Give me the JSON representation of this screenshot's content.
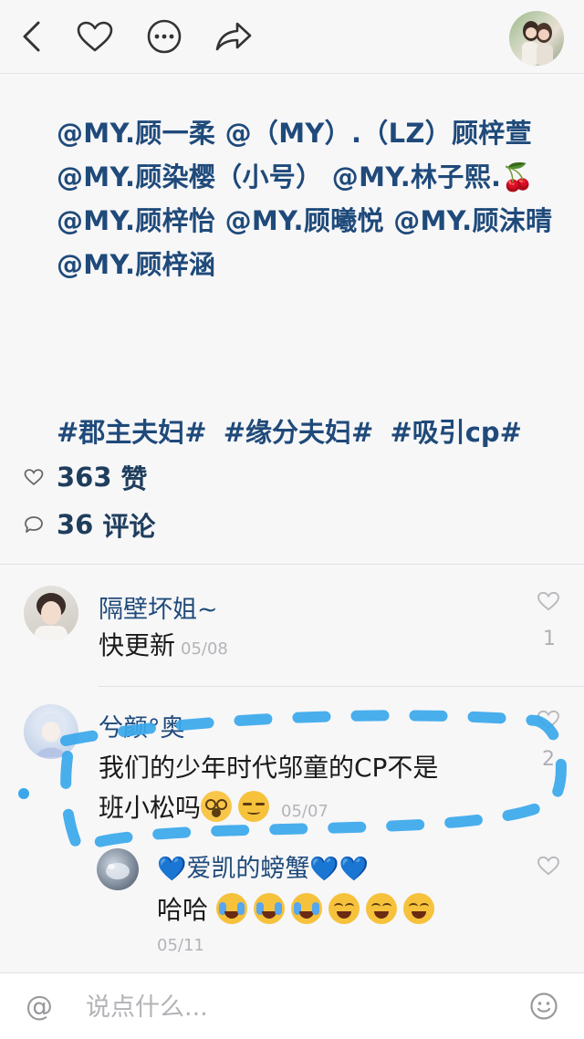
{
  "post": {
    "mentions": [
      "@MY.顾一柔",
      "@（MY）.（LZ）顾梓萱",
      "@MY.顾染樱（小号）",
      "@MY.林子熙.🍒",
      "@MY.顾梓怡",
      "@MY.顾曦悦",
      "@MY.顾沫晴",
      "@MY.顾梓涵"
    ],
    "hashtags": [
      "#郡主夫妇#",
      "#缘分夫妇#",
      "#吸引cp#"
    ]
  },
  "stats": {
    "likes_count": "363",
    "likes_label": "赞",
    "comments_count": "36",
    "comments_label": "评论"
  },
  "comments": [
    {
      "author": "隔壁坏姐~",
      "text": "快更新",
      "date": "05/08",
      "like_count": "1"
    },
    {
      "author": "兮颜°奥",
      "text_line1": "我们的少年时代邬童的CP不是",
      "text_line2": "班小松吗",
      "date": "05/07",
      "like_count": "2",
      "reply": {
        "author_prefix": "💙",
        "author": "爱凯的螃蟹",
        "author_suffix": "💙💙",
        "text": "哈哈",
        "date": "05/11"
      }
    }
  ],
  "composer": {
    "placeholder": "说点什么..."
  },
  "icons": {
    "back": "chevron-left-icon",
    "like": "heart-icon",
    "more": "more-icon",
    "share": "share-icon",
    "at": "at-icon",
    "emoji": "smile-icon"
  },
  "colors": {
    "link": "#1f4a7a",
    "annotation": "#3aa7ea"
  }
}
